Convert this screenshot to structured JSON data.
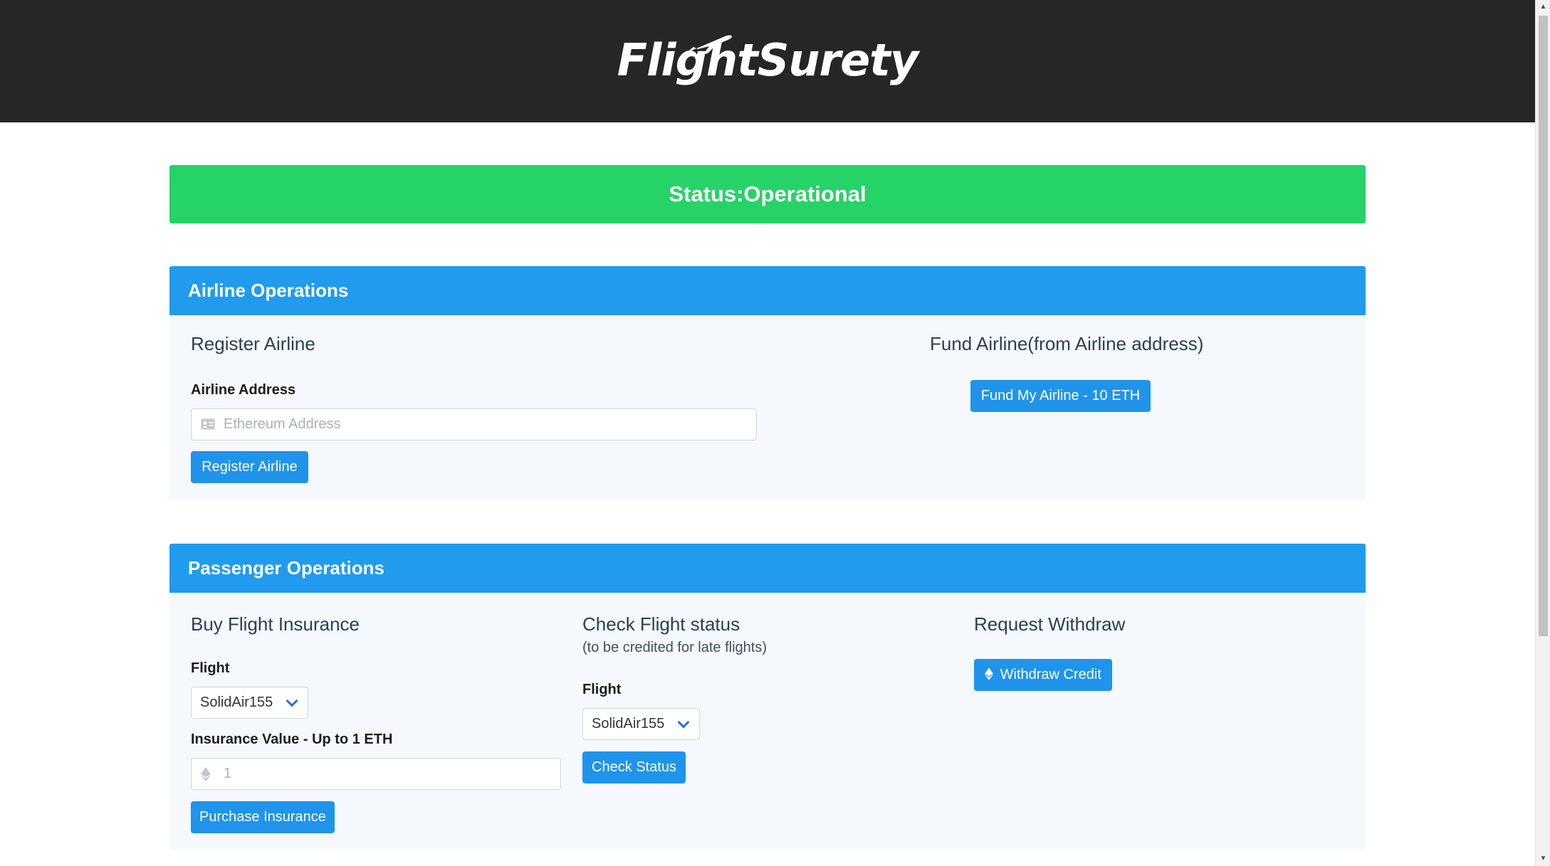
{
  "header": {
    "logo_text": "FlightSurety"
  },
  "status": {
    "text": "Status:Operational",
    "color": "#26d366"
  },
  "airline": {
    "card_title": "Airline Operations",
    "register": {
      "title": "Register Airline",
      "address_label": "Airline Address",
      "address_placeholder": "Ethereum Address",
      "address_icon": "id-card-icon",
      "button_label": "Register Airline"
    },
    "fund": {
      "title": "Fund Airline(from Airline address)",
      "button_label": "Fund My Airline - 10 ETH"
    }
  },
  "passenger": {
    "card_title": "Passenger Operations",
    "buy": {
      "title": "Buy Flight Insurance",
      "flight_label": "Flight",
      "flight_selected": "SolidAir155",
      "value_label": "Insurance Value - Up to 1 ETH",
      "value_input": "1",
      "value_icon": "ethereum-icon",
      "button_label": "Purchase Insurance"
    },
    "check": {
      "title": "Check Flight status",
      "subtitle": "(to be credited for late flights)",
      "flight_label": "Flight",
      "flight_selected": "SolidAir155",
      "button_label": "Check Status"
    },
    "withdraw": {
      "title": "Request Withdraw",
      "button_label": "Withdraw Credit",
      "button_icon": "ethereum-icon"
    }
  },
  "colors": {
    "topbar": "#262626",
    "card_header": "#219bed",
    "button": "#1f94ea",
    "card_body": "#f5f9fd"
  }
}
